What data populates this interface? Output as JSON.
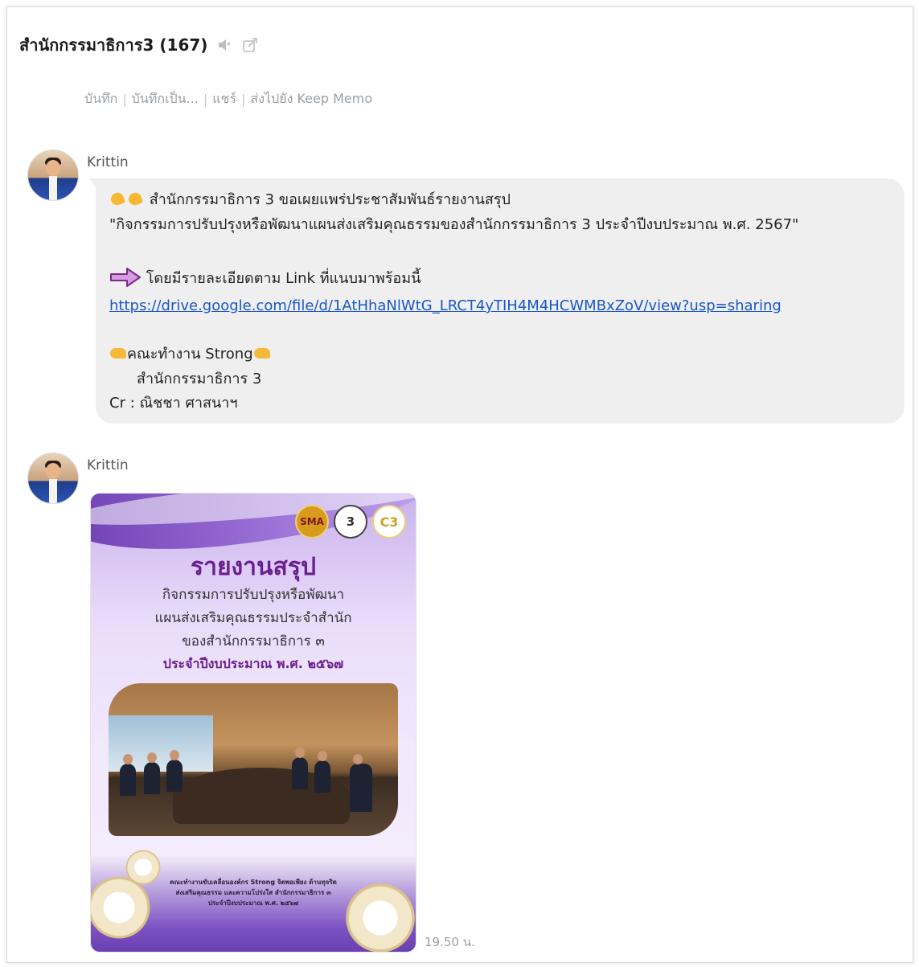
{
  "header": {
    "title": "สำนักกรรมาธิการ3 (167)",
    "mute_icon": "speaker-muted-icon",
    "popout_icon": "popout-window-icon"
  },
  "actions": [
    {
      "label": "บันทึก"
    },
    {
      "label": "บันทึกเป็น..."
    },
    {
      "label": "แชร์"
    },
    {
      "label": "ส่งไปยัง Keep Memo"
    }
  ],
  "messages": [
    {
      "sender": "Krittin",
      "lines": {
        "l1": "สำนักกรรมาธิการ 3 ขอเผยแพร่ประชาสัมพันธ์รายงานสรุป",
        "l2": "\"กิจกรรมการปรับปรุงหรือพัฒนาแผนส่งเสริมคุณธรรมของสำนักกรรมาธิการ 3 ประจำปีงบประมาณ พ.ศ. 2567\"",
        "l3": "โดยมีรายละเอียดตาม Link ที่แนบมาพร้อมนี้",
        "link": "https://drive.google.com/file/d/1AtHhaNlWtG_LRCT4yTIH4M4HCWMBxZoV/view?usp=sharing",
        "l4": "คณะทำงาน Strong",
        "l5": "สำนักกรรมาธิการ 3",
        "l6": "Cr : ณิชชา ศาสนาฯ"
      }
    },
    {
      "sender": "Krittin",
      "poster": {
        "logos": [
          "SMA",
          "3",
          "C3"
        ],
        "title": "รายงานสรุป",
        "line1": "กิจกรรมการปรับปรุงหรือพัฒนา",
        "line2": "แผนส่งเสริมคุณธรรมประจำสำนัก",
        "line3": "ของสำนักกรรมาธิการ ๓",
        "year": "ประจำปีงบประมาณ พ.ศ. ๒๕๖๗",
        "foot1": "คณะทำงานขับเคลื่อนองค์กร Strong จิตพอเพียง ต้านทุจริต",
        "foot2": "ส่งเสริมคุณธรรม และความโปร่งใส สำนักกรรมาธิการ ๓",
        "foot3": "ประจำปีงบประมาณ พ.ศ. ๒๕๖๗"
      },
      "time": "19.50 น."
    }
  ]
}
